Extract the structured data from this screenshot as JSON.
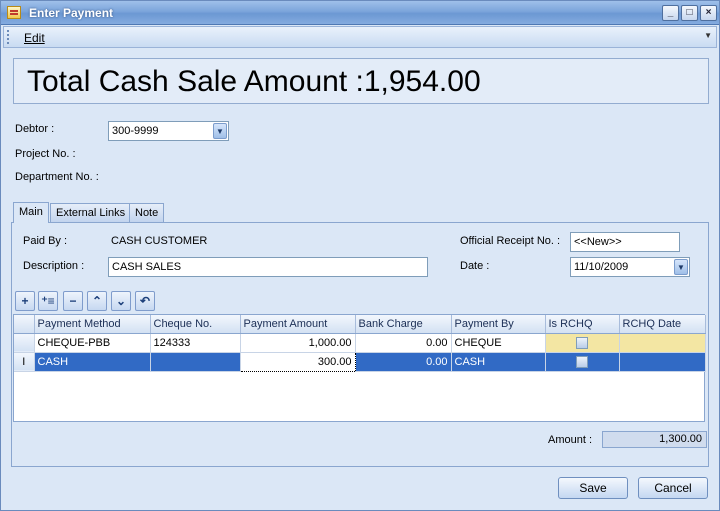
{
  "window": {
    "title": "Enter Payment"
  },
  "menu": {
    "edit": "Edit"
  },
  "banner": {
    "text": "Total Cash Sale Amount :1,954.00"
  },
  "form": {
    "debtor_label": "Debtor :",
    "debtor_value": "300-9999",
    "project_label": "Project No. :",
    "department_label": "Department No. :"
  },
  "tabs": [
    "Main",
    "External Links",
    "Note"
  ],
  "main": {
    "paid_by_label": "Paid By :",
    "paid_by_value": "CASH CUSTOMER",
    "description_label": "Description :",
    "description_value": "CASH SALES",
    "receipt_label": "Official Receipt No. :",
    "receipt_value": "<<New>>",
    "date_label": "Date :",
    "date_value": "11/10/2009"
  },
  "grid": {
    "columns": [
      "Payment Method",
      "Cheque No.",
      "Payment Amount",
      "Bank Charge",
      "Payment By",
      "Is RCHQ",
      "RCHQ Date"
    ],
    "rows": [
      {
        "method": "CHEQUE-PBB",
        "cheque": "124333",
        "amount": "1,000.00",
        "charge": "0.00",
        "by": "CHEQUE",
        "rchq_date": ""
      },
      {
        "method": "CASH",
        "cheque": "",
        "amount": "300.00",
        "charge": "0.00",
        "by": "CASH",
        "rchq_date": ""
      }
    ],
    "row_indicator": "I"
  },
  "footer": {
    "amount_label": "Amount :",
    "amount_value": "1,300.00",
    "save": "Save",
    "cancel": "Cancel"
  }
}
